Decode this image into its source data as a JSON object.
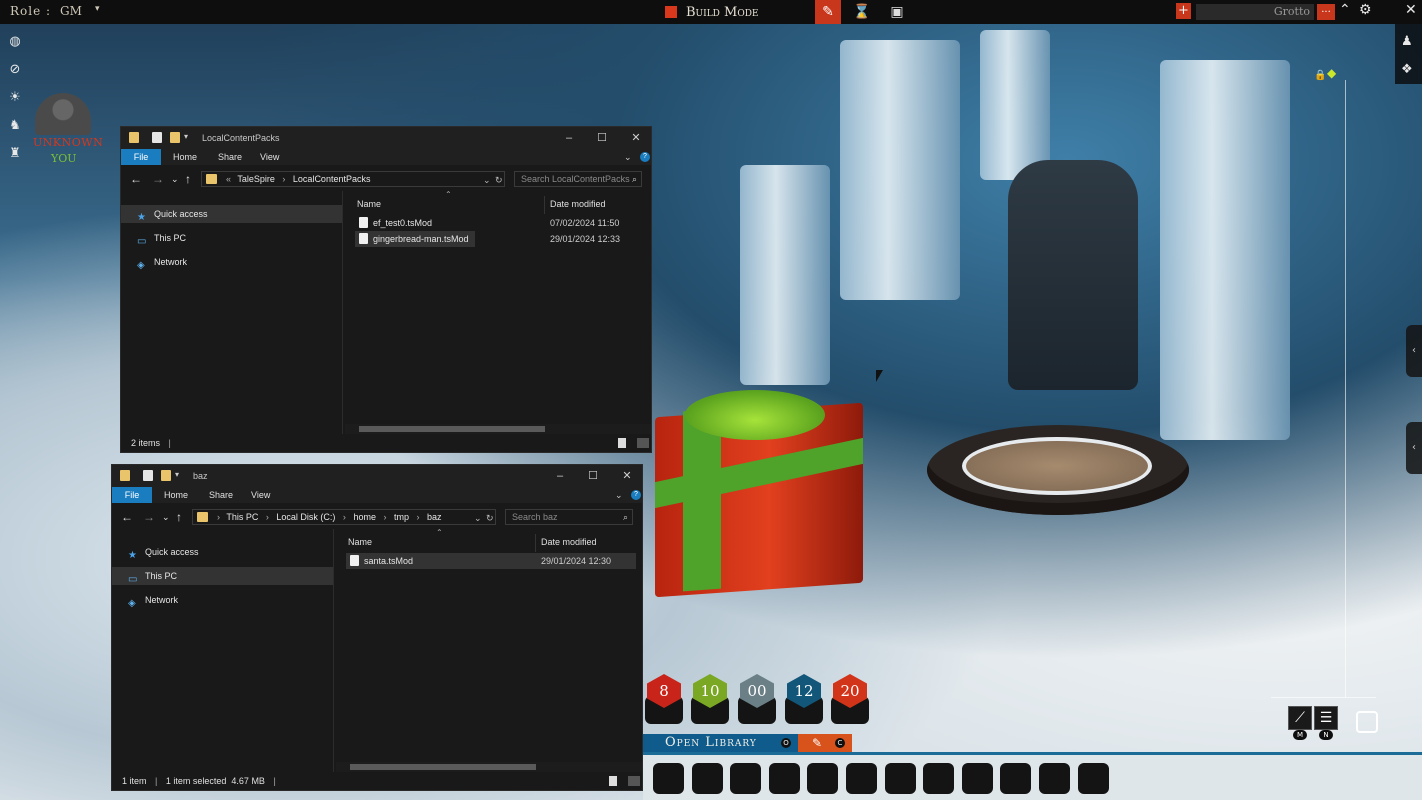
{
  "topbar": {
    "role_label": "Role :",
    "role_value": "GM",
    "role_caret": "▾",
    "mode_label": "Build Mode",
    "board_name": "Grotto",
    "board_menu": "...",
    "add_icon": "+",
    "tools": [
      "paint-icon",
      "hourglass-icon",
      "film-icon"
    ]
  },
  "left_sidebar": {
    "icons": [
      "globe-icon",
      "eye-off-icon",
      "sun-icon",
      "party-icon",
      "creature-icon"
    ],
    "player_name": "Unknown",
    "player_you": "You"
  },
  "explorer1": {
    "title": "LocalContentPacks",
    "tabs": [
      "File",
      "Home",
      "Share",
      "View"
    ],
    "crumbs": [
      "TaleSpire",
      "LocalContentPacks"
    ],
    "search_placeholder": "Search LocalContentPacks",
    "nav": [
      "Quick access",
      "This PC",
      "Network"
    ],
    "col_name": "Name",
    "col_date": "Date modified",
    "files": [
      {
        "name": "ef_test0.tsMod",
        "date": "07/02/2024 11:50"
      },
      {
        "name": "gingerbread-man.tsMod",
        "date": "29/01/2024 12:33"
      }
    ],
    "status": "2 items"
  },
  "explorer2": {
    "title": "baz",
    "tabs": [
      "File",
      "Home",
      "Share",
      "View"
    ],
    "crumbs": [
      "This PC",
      "Local Disk (C:)",
      "home",
      "tmp",
      "baz"
    ],
    "search_placeholder": "Search baz",
    "nav": [
      "Quick access",
      "This PC",
      "Network"
    ],
    "col_name": "Name",
    "col_date": "Date modified",
    "files": [
      {
        "name": "santa.tsMod",
        "date": "29/01/2024 12:30"
      }
    ],
    "status_items": "1 item",
    "status_selected": "1 item selected  4.67 MB"
  },
  "dice": [
    {
      "label": "8",
      "color": "#c9241a"
    },
    {
      "label": "10",
      "color": "#7aa824"
    },
    {
      "label": "00",
      "color": "#6b7f86"
    },
    {
      "label": "12",
      "color": "#12577a"
    },
    {
      "label": "20",
      "color": "#d23419"
    }
  ],
  "bottombar": {
    "library_label": "Open Library",
    "library_key": "O",
    "pen_key": "C"
  },
  "map_tools": {
    "line_key": "M",
    "plane_key": "N"
  },
  "colors": {
    "accent": "#c8361b",
    "library_blue": "#0f5c8c",
    "explorer_blue": "#1a7dbf"
  }
}
